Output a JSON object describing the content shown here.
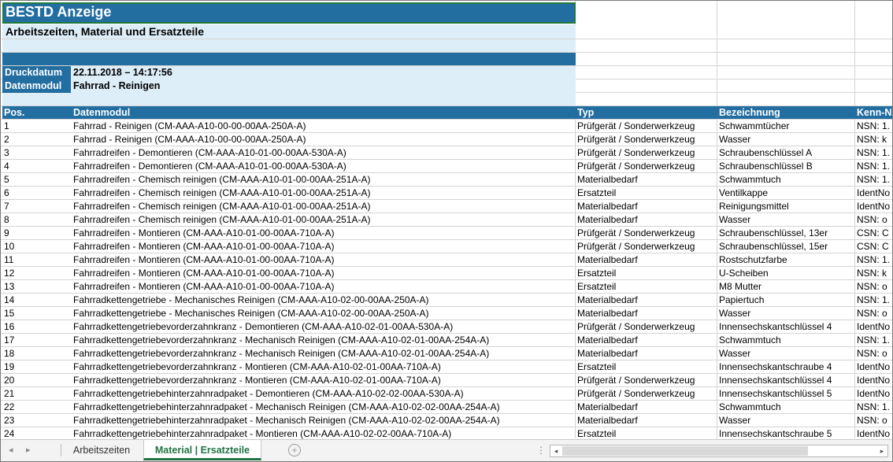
{
  "sheet": {
    "title": "BESTD Anzeige",
    "subtitle": "Arbeitszeiten, Material und Ersatzteile",
    "meta": [
      {
        "label": "Druckdatum",
        "value": "22.11.2018 – 14:17:56"
      },
      {
        "label": "Datenmodul",
        "value": "Fahrrad - Reinigen"
      }
    ],
    "columns": [
      "Pos.",
      "Datenmodul",
      "Typ",
      "Bezeichnung",
      "Kenn-N"
    ],
    "rows": [
      [
        "1",
        "Fahrrad - Reinigen (CM-AAA-A10-00-00-00AA-250A-A)",
        "Prüfgerät / Sonderwerkzeug",
        "Schwammtücher",
        "NSN: 1."
      ],
      [
        "2",
        "Fahrrad - Reinigen (CM-AAA-A10-00-00-00AA-250A-A)",
        "Prüfgerät / Sonderwerkzeug",
        "Wasser",
        "NSN: k"
      ],
      [
        "3",
        "Fahrradreifen - Demontieren (CM-AAA-A10-01-00-00AA-530A-A)",
        "Prüfgerät / Sonderwerkzeug",
        "Schraubenschlüssel A",
        "NSN: 1."
      ],
      [
        "4",
        "Fahrradreifen - Demontieren (CM-AAA-A10-01-00-00AA-530A-A)",
        "Prüfgerät / Sonderwerkzeug",
        "Schraubenschlüssel B",
        "NSN: 1."
      ],
      [
        "5",
        "Fahrradreifen - Chemisch reinigen (CM-AAA-A10-01-00-00AA-251A-A)",
        "Materialbedarf",
        "Schwammtuch",
        "NSN: 1."
      ],
      [
        "6",
        "Fahrradreifen - Chemisch reinigen (CM-AAA-A10-01-00-00AA-251A-A)",
        "Ersatzteil",
        "Ventilkappe",
        "IdentNo"
      ],
      [
        "7",
        "Fahrradreifen - Chemisch reinigen (CM-AAA-A10-01-00-00AA-251A-A)",
        "Materialbedarf",
        "Reinigungsmittel",
        "IdentNo"
      ],
      [
        "8",
        "Fahrradreifen - Chemisch reinigen (CM-AAA-A10-01-00-00AA-251A-A)",
        "Materialbedarf",
        "Wasser",
        "NSN: o"
      ],
      [
        "9",
        "Fahrradreifen - Montieren (CM-AAA-A10-01-00-00AA-710A-A)",
        "Prüfgerät / Sonderwerkzeug",
        "Schraubenschlüssel, 13er",
        "CSN: C"
      ],
      [
        "10",
        "Fahrradreifen - Montieren (CM-AAA-A10-01-00-00AA-710A-A)",
        "Prüfgerät / Sonderwerkzeug",
        "Schraubenschlüssel, 15er",
        "CSN: C"
      ],
      [
        "11",
        "Fahrradreifen - Montieren (CM-AAA-A10-01-00-00AA-710A-A)",
        "Materialbedarf",
        "Rostschutzfarbe",
        "NSN: 1."
      ],
      [
        "12",
        "Fahrradreifen - Montieren (CM-AAA-A10-01-00-00AA-710A-A)",
        "Ersatzteil",
        "U-Scheiben",
        "NSN: k"
      ],
      [
        "13",
        "Fahrradreifen - Montieren (CM-AAA-A10-01-00-00AA-710A-A)",
        "Ersatzteil",
        "M8 Mutter",
        "NSN: o"
      ],
      [
        "14",
        "Fahrradkettengetriebe - Mechanisches Reinigen (CM-AAA-A10-02-00-00AA-250A-A)",
        "Materialbedarf",
        "Papiertuch",
        "NSN: 1."
      ],
      [
        "15",
        "Fahrradkettengetriebe - Mechanisches Reinigen (CM-AAA-A10-02-00-00AA-250A-A)",
        "Materialbedarf",
        "Wasser",
        "NSN: o"
      ],
      [
        "16",
        "Fahrradkettengetriebevorderzahnkranz - Demontieren (CM-AAA-A10-02-01-00AA-530A-A)",
        "Prüfgerät / Sonderwerkzeug",
        "Innensechskantschlüssel 4",
        "IdentNo"
      ],
      [
        "17",
        "Fahrradkettengetriebevorderzahnkranz - Mechanisch Reinigen (CM-AAA-A10-02-01-00AA-254A-A)",
        "Materialbedarf",
        "Schwammtuch",
        "NSN: 1."
      ],
      [
        "18",
        "Fahrradkettengetriebevorderzahnkranz - Mechanisch Reinigen (CM-AAA-A10-02-01-00AA-254A-A)",
        "Materialbedarf",
        "Wasser",
        "NSN: o"
      ],
      [
        "19",
        "Fahrradkettengetriebevorderzahnkranz - Montieren (CM-AAA-A10-02-01-00AA-710A-A)",
        "Ersatzteil",
        "Innensechskantschraube 4",
        "IdentNo"
      ],
      [
        "20",
        "Fahrradkettengetriebevorderzahnkranz - Montieren (CM-AAA-A10-02-01-00AA-710A-A)",
        "Prüfgerät / Sonderwerkzeug",
        "Innensechskantschlüssel 4",
        "IdentNo"
      ],
      [
        "21",
        "Fahrradkettengetriebehinterzahnradpaket - Demontieren (CM-AAA-A10-02-02-00AA-530A-A)",
        "Prüfgerät / Sonderwerkzeug",
        "Innensechskantschlüssel 5",
        "IdentNo"
      ],
      [
        "22",
        "Fahrradkettengetriebehinterzahnradpaket - Mechanisch Reinigen (CM-AAA-A10-02-02-00AA-254A-A)",
        "Materialbedarf",
        "Schwammtuch",
        "NSN: 1."
      ],
      [
        "23",
        "Fahrradkettengetriebehinterzahnradpaket - Mechanisch Reinigen (CM-AAA-A10-02-02-00AA-254A-A)",
        "Materialbedarf",
        "Wasser",
        "NSN: o"
      ],
      [
        "24",
        "Fahrradkettengetriebehinterzahnradpaket - Montieren (CM-AAA-A10-02-02-00AA-710A-A)",
        "Ersatzteil",
        "Innensechskantschraube 5",
        "IdentNo"
      ]
    ]
  },
  "tabs": {
    "nav_left": "◂",
    "nav_right": "▸",
    "items": [
      {
        "label": "Arbeitszeiten",
        "active": false
      },
      {
        "label": "Material | Ersatzteile",
        "active": true
      }
    ],
    "add_icon": "+",
    "more_icon": "⋮"
  },
  "colors": {
    "header_blue": "#236ea1",
    "light_blue": "#ddeef9",
    "active_tab_green": "#217346"
  }
}
